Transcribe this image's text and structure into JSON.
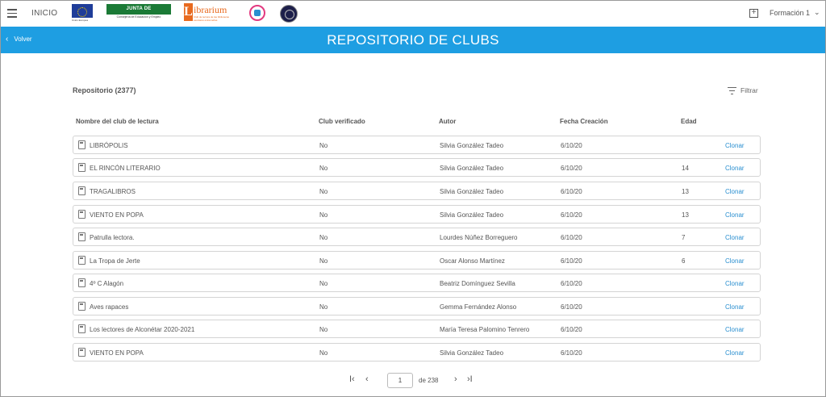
{
  "topbar": {
    "home_label": "INICIO",
    "eu_caption": "Unión Europea",
    "junta_label": "JUNTA DE EXTREMADURA",
    "junta_caption": "Consejería de Educación y Empleo",
    "librarium_letter": "L",
    "librarium_word": "ibrarium",
    "librarium_sub": "Club de lectura de las bibliotecas escolares extremeñas",
    "course_label": "Formación 1",
    "plus_glyph": "+",
    "chevron_glyph": "⌄"
  },
  "header": {
    "back_label": "Volver",
    "title": "REPOSITORIO DE CLUBS",
    "color": "#1e9ee2"
  },
  "repository": {
    "title": "Repositorio (2377)",
    "filter_label": "Filtrar",
    "columns": [
      "Nombre del club de lectura",
      "Club verificado",
      "Autor",
      "Fecha Creación",
      "Edad"
    ],
    "clone_label": "Clonar",
    "rows": [
      {
        "name": "LIBRÓPOLIS",
        "verified": "No",
        "author": "Silvia González Tadeo",
        "date": "6/10/20",
        "age": ""
      },
      {
        "name": "EL RINCÓN LITERARIO",
        "verified": "No",
        "author": "Silvia González Tadeo",
        "date": "6/10/20",
        "age": "14"
      },
      {
        "name": "TRAGALIBROS",
        "verified": "No",
        "author": "Silvia González Tadeo",
        "date": "6/10/20",
        "age": "13"
      },
      {
        "name": "VIENTO EN POPA",
        "verified": "No",
        "author": "Silvia González Tadeo",
        "date": "6/10/20",
        "age": "13"
      },
      {
        "name": "Patrulla lectora.",
        "verified": "No",
        "author": "Lourdes Núñez Borreguero",
        "date": "6/10/20",
        "age": "7"
      },
      {
        "name": "La Tropa de Jerte",
        "verified": "No",
        "author": "Oscar Alonso Martínez",
        "date": "6/10/20",
        "age": "6"
      },
      {
        "name": "4º C Alagón",
        "verified": "No",
        "author": "Beatriz Domínguez Sevilla",
        "date": "6/10/20",
        "age": ""
      },
      {
        "name": "Aves rapaces",
        "verified": "No",
        "author": "Gemma Fernández Alonso",
        "date": "6/10/20",
        "age": ""
      },
      {
        "name": "Los lectores de Alconétar 2020-2021",
        "verified": "No",
        "author": "María Teresa Palomino Tenrero",
        "date": "6/10/20",
        "age": ""
      },
      {
        "name": "VIENTO EN POPA",
        "verified": "No",
        "author": "Silvia González Tadeo",
        "date": "6/10/20",
        "age": ""
      }
    ]
  },
  "pagination": {
    "current_page": "1",
    "of_label": "de 238",
    "first_glyph": "I‹",
    "prev_glyph": "‹",
    "next_glyph": "›",
    "last_glyph": "›I"
  }
}
